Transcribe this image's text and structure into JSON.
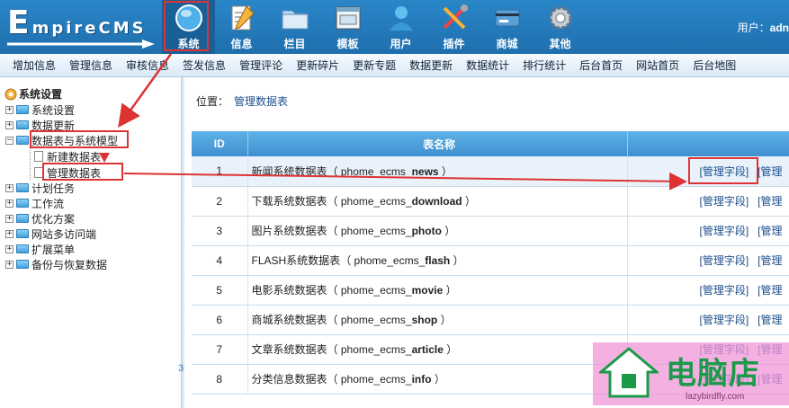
{
  "app": {
    "logo_letter": "E",
    "logo_rest": "mpireCMS"
  },
  "nav": [
    {
      "label": "系统",
      "icon": "globe-icon",
      "active": true
    },
    {
      "label": "信息",
      "icon": "notepad-icon"
    },
    {
      "label": "栏目",
      "icon": "folder-icon"
    },
    {
      "label": "模板",
      "icon": "window-icon"
    },
    {
      "label": "用户",
      "icon": "user-icon"
    },
    {
      "label": "插件",
      "icon": "tools-icon"
    },
    {
      "label": "商城",
      "icon": "card-icon"
    },
    {
      "label": "其他",
      "icon": "gear-icon"
    }
  ],
  "user": {
    "label": "用户：",
    "name": "adn"
  },
  "menubar": [
    "增加信息",
    "管理信息",
    "审核信息",
    "签发信息",
    "管理评论",
    "更新碎片",
    "更新专题",
    "数据更新",
    "数据统计",
    "排行统计",
    "后台首页",
    "网站首页",
    "后台地图"
  ],
  "tree": {
    "root": "系统设置",
    "items": [
      "系统设置",
      "数据更新",
      "数据表与系统模型",
      "计划任务",
      "工作流",
      "优化方案",
      "网站多访问端",
      "扩展菜单",
      "备份与恢复数据"
    ],
    "children": [
      "新建数据表",
      "管理数据表"
    ]
  },
  "location": {
    "label": "位置：",
    "link": "管理数据表"
  },
  "table": {
    "headers": [
      "ID",
      "表名称",
      ""
    ],
    "action_manage": "[管理字段]",
    "action_more": "[管理",
    "rows": [
      {
        "id": "1",
        "cn": "新闻系统数据表",
        "prefix": "phome_ecms_",
        "suffix": "news"
      },
      {
        "id": "2",
        "cn": "下载系统数据表",
        "prefix": "phome_ecms_",
        "suffix": "download"
      },
      {
        "id": "3",
        "cn": "图片系统数据表",
        "prefix": "phome_ecms_",
        "suffix": "photo"
      },
      {
        "id": "4",
        "cn": "FLASH系统数据表",
        "prefix": "phome_ecms_",
        "suffix": "flash"
      },
      {
        "id": "5",
        "cn": "电影系统数据表",
        "prefix": "phome_ecms_",
        "suffix": "movie"
      },
      {
        "id": "6",
        "cn": "商城系统数据表",
        "prefix": "phome_ecms_",
        "suffix": "shop"
      },
      {
        "id": "7",
        "cn": "文章系统数据表",
        "prefix": "phome_ecms_",
        "suffix": "article"
      },
      {
        "id": "8",
        "cn": "分类信息数据表",
        "prefix": "phome_ecms_",
        "suffix": "info"
      }
    ]
  },
  "side_number": "3",
  "watermark": {
    "text": "电脑店",
    "url": "lazybirdfly.com"
  },
  "colors": {
    "accent": "#1f6fae",
    "annotation_red": "#d33"
  }
}
